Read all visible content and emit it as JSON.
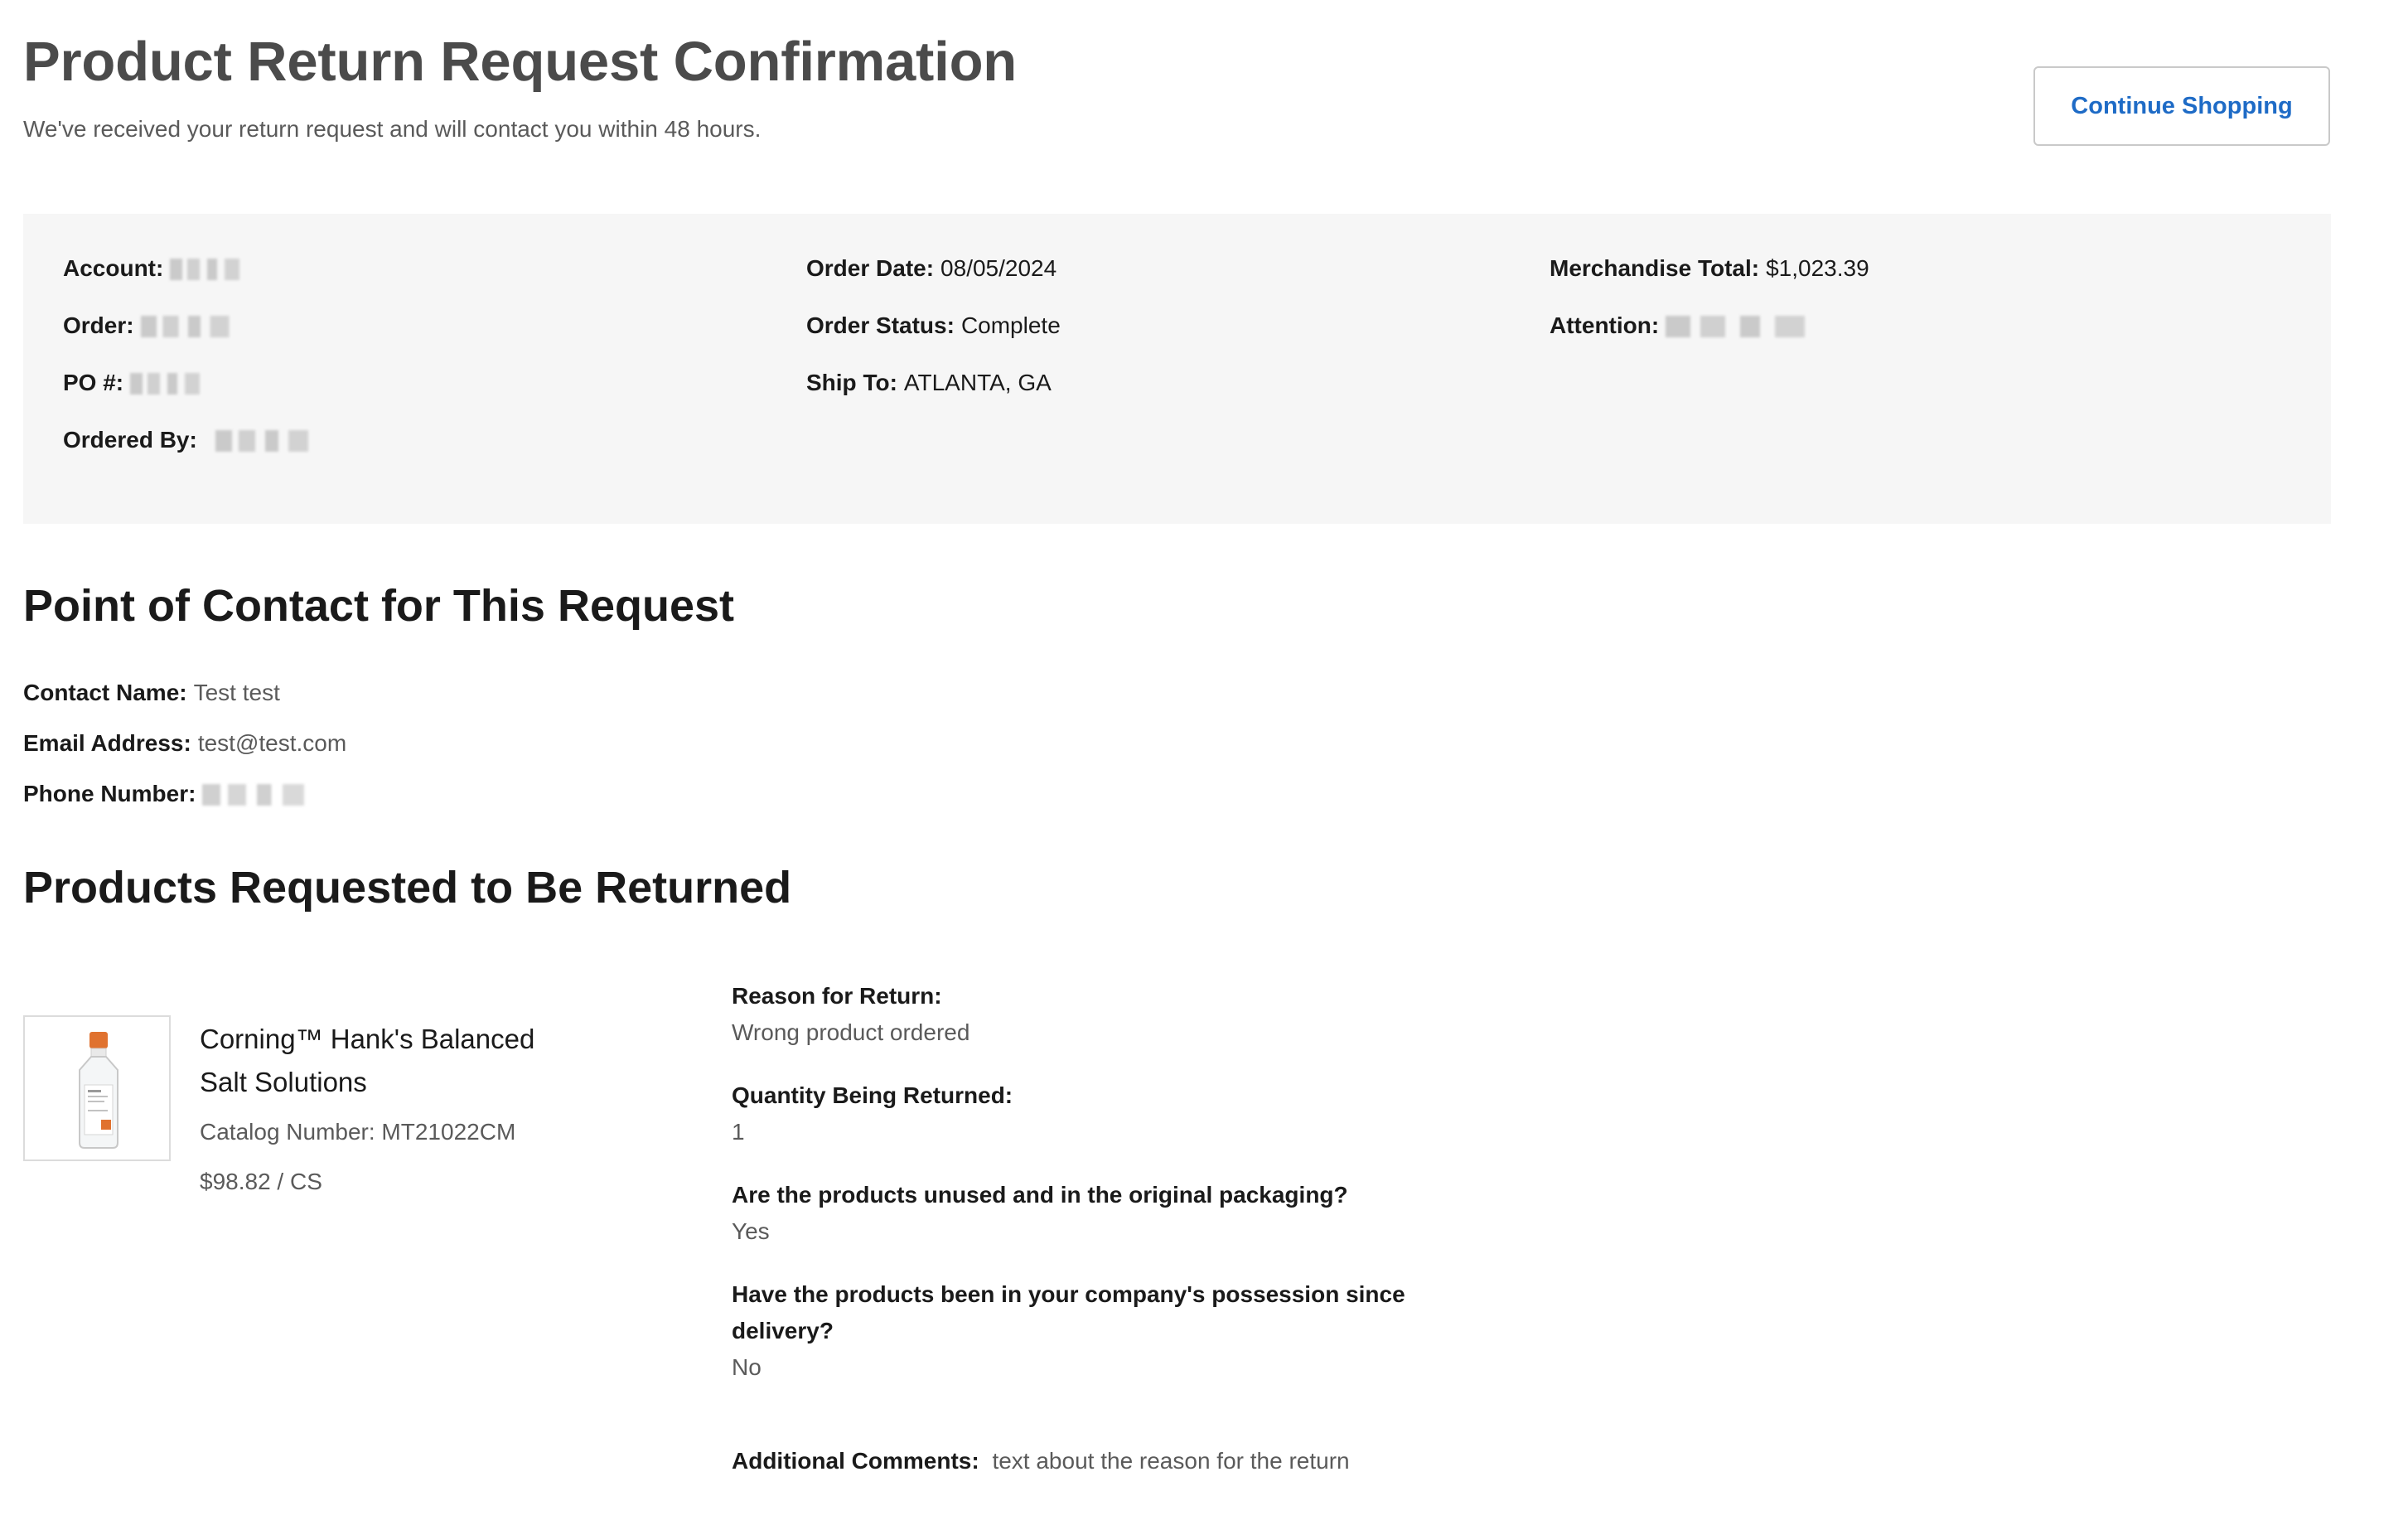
{
  "header": {
    "title": "Product Return Request Confirmation",
    "subtitle": "We've received your return request and will contact you within 48 hours.",
    "continue_label": "Continue Shopping"
  },
  "summary": {
    "account_label": "Account:",
    "order_label": "Order:",
    "po_label": "PO #:",
    "ordered_by_label": "Ordered By:",
    "order_date_label": "Order Date:",
    "order_date": "08/05/2024",
    "order_status_label": "Order Status:",
    "order_status": "Complete",
    "ship_to_label": "Ship To:",
    "ship_to": "ATLANTA, GA",
    "merch_total_label": "Merchandise Total:",
    "merch_total": "$1,023.39",
    "attention_label": "Attention:"
  },
  "contact": {
    "title": "Point of Contact for This Request",
    "name_label": "Contact Name:",
    "name": "Test test",
    "email_label": "Email Address:",
    "email": "test@test.com",
    "phone_label": "Phone Number:"
  },
  "products": {
    "title": "Products Requested to Be Returned",
    "item": {
      "name": "Corning™ Hank's Balanced Salt Solutions",
      "catalog": "Catalog Number: MT21022CM",
      "price": "$98.82 / CS"
    },
    "reason_label": "Reason for Return:",
    "reason": "Wrong product ordered",
    "quantity_label": "Quantity Being Returned:",
    "quantity": "1",
    "unused_label": "Are the products unused and in the original packaging?",
    "unused": "Yes",
    "possession_label": "Have the products been in your company's possession since delivery?",
    "possession": "No",
    "comments_label": "Additional Comments:",
    "comments": "text about the reason for the return"
  },
  "colors": {
    "link_blue": "#1e6bc6",
    "bottle_cap": "#e0722f",
    "summary_bg": "#f6f6f6"
  }
}
